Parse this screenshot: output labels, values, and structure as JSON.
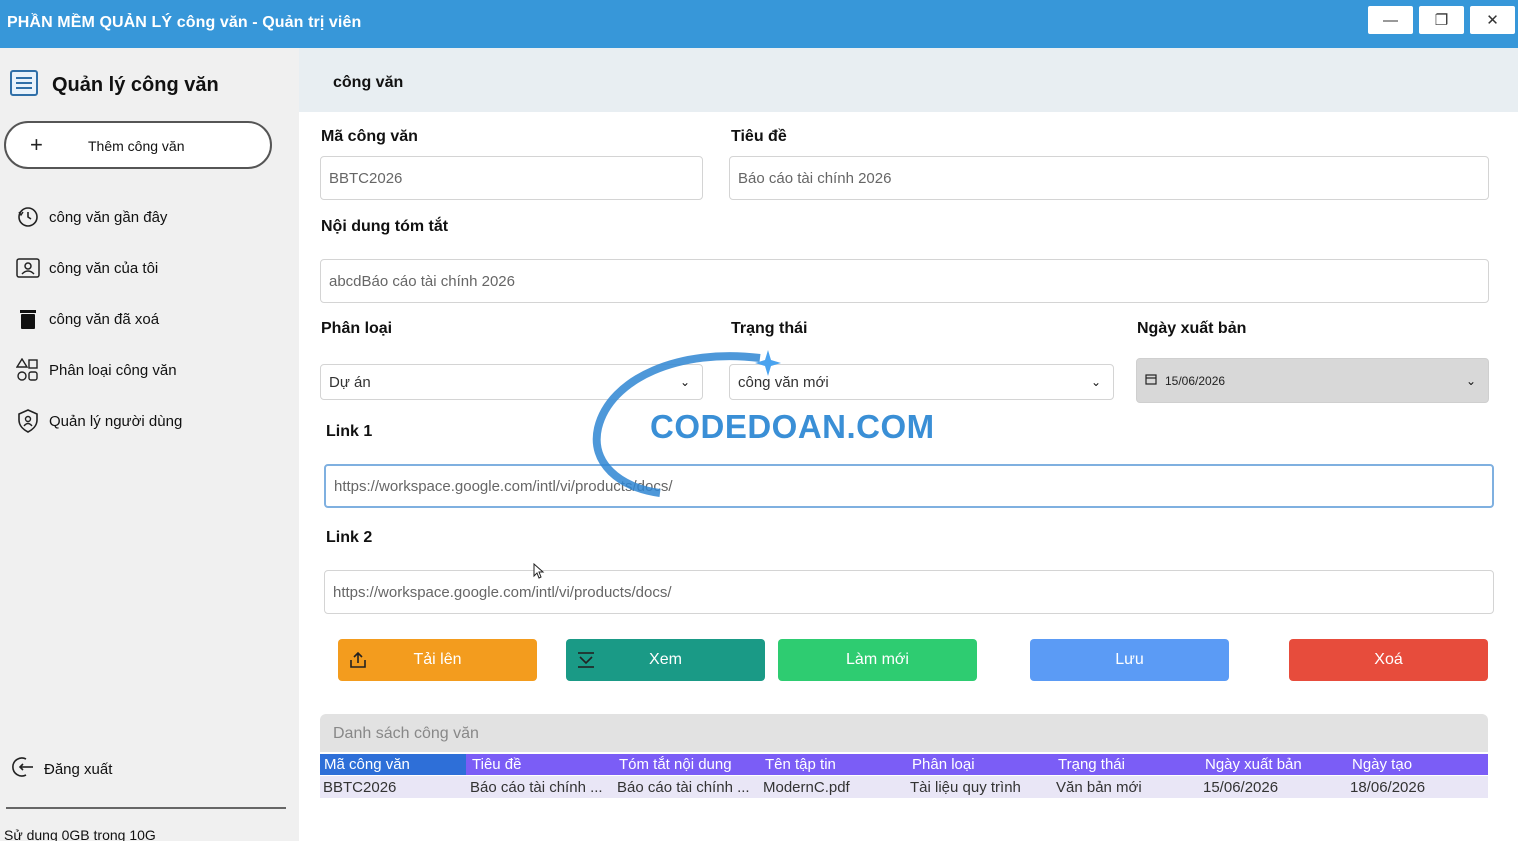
{
  "window": {
    "title": "PHẦN MỀM QUẢN LÝ công văn - Quản trị viên",
    "minimize_glyph": "—",
    "restore_glyph": "❐",
    "close_glyph": "✕"
  },
  "sidebar": {
    "brand": "Quản lý công văn",
    "add_button": "Thêm công văn",
    "items": [
      {
        "label": "công văn gần đây",
        "icon": "history-icon"
      },
      {
        "label": "công văn của tôi",
        "icon": "user-card-icon"
      },
      {
        "label": "công văn đã xoá",
        "icon": "trash-icon"
      },
      {
        "label": "Phân loại công văn",
        "icon": "category-icon"
      },
      {
        "label": "Quản lý người dùng",
        "icon": "shield-user-icon"
      }
    ],
    "logout": "Đăng xuất",
    "usage": "Sử dụng 0GB trong 10G"
  },
  "main": {
    "header": "công văn",
    "labels": {
      "code": "Mã công văn",
      "title": "Tiêu đề",
      "summary": "Nội dung tóm tắt",
      "category": "Phân loại",
      "status": "Trạng thái",
      "publish_date": "Ngày xuất bản",
      "link1": "Link 1",
      "link2": "Link 2"
    },
    "values": {
      "code": "BBTC2026",
      "title": "Báo cáo tài chính 2026",
      "summary": "abcdBáo cáo tài chính 2026",
      "category": "Dự án",
      "status": "công văn mới",
      "publish_date": "15/06/2026",
      "link1": "https://workspace.google.com/intl/vi/products/docs/",
      "link2": "https://workspace.google.com/intl/vi/products/docs/"
    },
    "buttons": {
      "upload": "Tải lên",
      "view": "Xem",
      "refresh": "Làm mới",
      "save": "Lưu",
      "delete": "Xoá"
    },
    "colors": {
      "upload": "#f39c1e",
      "view": "#1a9a86",
      "refresh": "#2ecc71",
      "save": "#5b9bf5",
      "delete": "#e74c3c"
    }
  },
  "table": {
    "caption": "Danh sách công văn",
    "columns": [
      "Mã công văn",
      "Tiêu đề",
      "Tóm tắt nội dung",
      "Tên tập tin",
      "Phân loại",
      "Trạng thái",
      "Ngày xuất bản",
      "Ngày tạo"
    ],
    "rows": [
      [
        "BBTC2026",
        "Báo cáo tài chính ...",
        "Báo cáo tài chính ...",
        "ModernC.pdf",
        "Tài liệu quy trình",
        "Văn bản mới",
        "15/06/2026",
        "18/06/2026"
      ]
    ]
  },
  "watermark": {
    "text": "CODEDOAN.COM"
  }
}
